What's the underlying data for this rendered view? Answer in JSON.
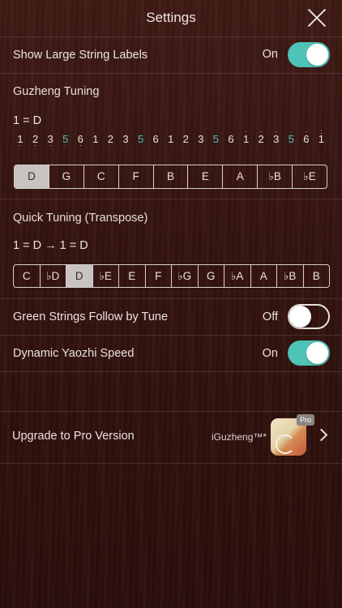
{
  "nav": {
    "title": "Settings"
  },
  "large_labels": {
    "label": "Show Large String Labels",
    "state": "On"
  },
  "guzheng_tuning": {
    "title": "Guzheng Tuning",
    "key": "1 = D",
    "notes": [
      {
        "n": "1",
        "dot": "below",
        "green": false
      },
      {
        "n": "2",
        "dot": "below",
        "green": false
      },
      {
        "n": "3",
        "dot": "below",
        "green": false
      },
      {
        "n": "5",
        "dot": "below",
        "green": true
      },
      {
        "n": "6",
        "dot": "below",
        "green": false
      },
      {
        "n": "1",
        "dot": "none",
        "green": false
      },
      {
        "n": "2",
        "dot": "none",
        "green": false
      },
      {
        "n": "3",
        "dot": "none",
        "green": false
      },
      {
        "n": "5",
        "dot": "none",
        "green": true
      },
      {
        "n": "6",
        "dot": "none",
        "green": false
      },
      {
        "n": "1",
        "dot": "none",
        "green": false
      },
      {
        "n": "2",
        "dot": "none",
        "green": false
      },
      {
        "n": "3",
        "dot": "none",
        "green": false
      },
      {
        "n": "5",
        "dot": "none",
        "green": true
      },
      {
        "n": "6",
        "dot": "none",
        "green": false
      },
      {
        "n": "1",
        "dot": "above",
        "green": false
      },
      {
        "n": "2",
        "dot": "above",
        "green": false
      },
      {
        "n": "3",
        "dot": "above",
        "green": false
      },
      {
        "n": "5",
        "dot": "above",
        "green": true
      },
      {
        "n": "6",
        "dot": "above",
        "green": false
      },
      {
        "n": "1",
        "dot": "above2",
        "green": false
      }
    ],
    "keys": [
      "D",
      "G",
      "C",
      "F",
      "B",
      "E",
      "A",
      "♭B",
      "♭E"
    ],
    "selected": "D"
  },
  "quick_tuning": {
    "title": "Quick Tuning  (Transpose)",
    "key_line": "1 = D → 1 = D",
    "keys": [
      "C",
      "♭D",
      "D",
      "♭E",
      "E",
      "F",
      "♭G",
      "G",
      "♭A",
      "A",
      "♭B",
      "B"
    ],
    "selected": "D"
  },
  "green_strings": {
    "label": "Green Strings Follow by Tune",
    "state": "Off"
  },
  "yaozhi": {
    "label": "Dynamic Yaozhi Speed",
    "state": "On"
  },
  "upgrade": {
    "label": "Upgrade to Pro Version",
    "brand": "iGuzheng™*",
    "badge": "Pro"
  },
  "colors": {
    "accent": "#4ec3b6",
    "background": "#34130f"
  }
}
